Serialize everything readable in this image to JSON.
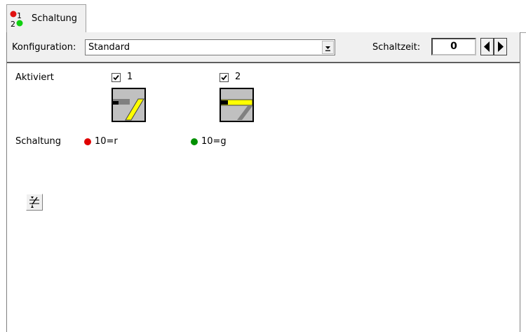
{
  "tab": {
    "label": "Schaltung",
    "icon": "signal-switch-icon",
    "icon_digits": [
      "1",
      "2"
    ],
    "icon_colors": [
      "#e01010",
      "#10d010"
    ]
  },
  "toolbar": {
    "config_label": "Konfiguration:",
    "config_value": "Standard",
    "schaltzeit_label": "Schaltzeit:",
    "schaltzeit_value": "0"
  },
  "content": {
    "aktiviert_label": "Aktiviert",
    "schaltung_label": "Schaltung",
    "routes": [
      {
        "checkbox_label": "1",
        "checked": true,
        "status": "10=r",
        "status_color": "#e00000",
        "icon": "turnout-diverging-icon"
      },
      {
        "checkbox_label": "2",
        "checked": true,
        "status": "10=g",
        "status_color": "#009000",
        "icon": "turnout-straight-icon"
      }
    ],
    "apply_button_icon": "apply-settings-icon"
  },
  "colors": {
    "route_highlight": "#ffff00",
    "panel_bg": "#f0f0f0"
  }
}
